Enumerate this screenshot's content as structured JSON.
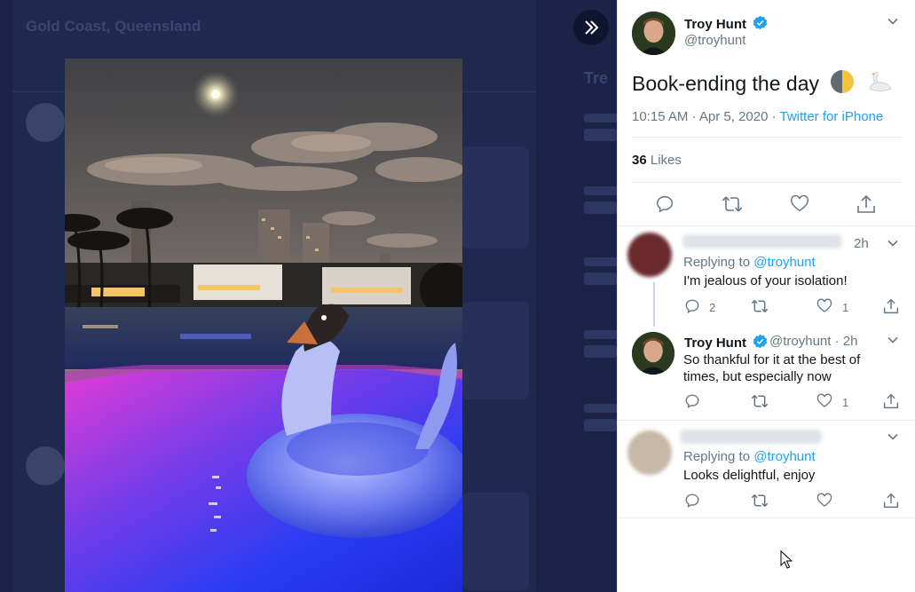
{
  "background": {
    "location_title": "Gold Coast, Queensland",
    "trends_title": "Tre"
  },
  "main_tweet": {
    "author_name": "Troy Hunt",
    "author_handle": "@troyhunt",
    "text": "Book-ending the day",
    "emojis": [
      "half-moon-icon",
      "swan-icon"
    ],
    "time": "10:15 AM · Apr 5, 2020",
    "separator": " · ",
    "source": "Twitter for iPhone",
    "likes_count": "36",
    "likes_label": "Likes"
  },
  "replies": [
    {
      "author": "",
      "time": "2h",
      "replying_prefix": "Replying to ",
      "replying_to": "@troyhunt",
      "text": "I'm jealous of your isolation!",
      "reply_count": "2",
      "like_count": "1"
    },
    {
      "author": "Troy Hunt",
      "handle_time": "@troyhunt · 2h",
      "text_line1": "So thankful for it at the best of",
      "text_line2": "times, but especially now",
      "reply_count": "",
      "like_count": "1"
    },
    {
      "author": "",
      "replying_prefix": "Replying to ",
      "replying_to": "@troyhunt",
      "text": "Looks delightful, enjoy",
      "reply_count": "",
      "like_count": ""
    }
  ],
  "colors": {
    "accent": "#1da1f2",
    "text": "#14171a",
    "muted": "#657786",
    "overlay": "#1b2447"
  }
}
